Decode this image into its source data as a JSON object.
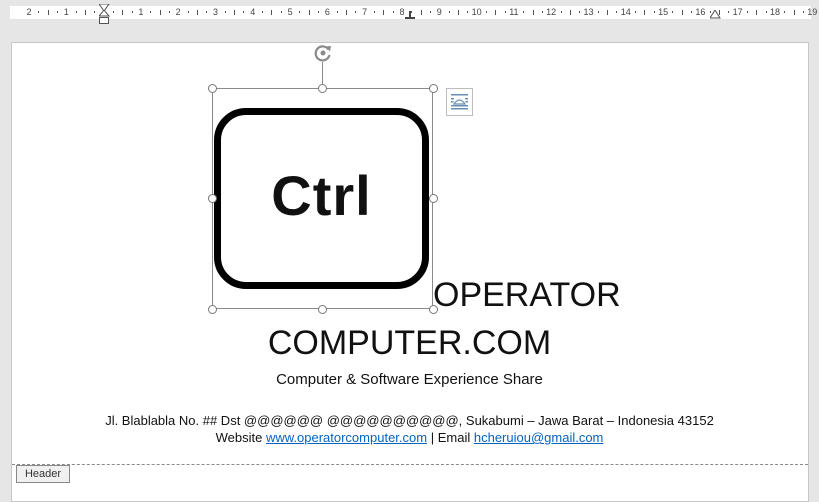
{
  "ruler": {
    "numbers": [
      "2",
      "1",
      "",
      "1",
      "2",
      "3",
      "4",
      "5",
      "6",
      "7",
      "8",
      "9",
      "10",
      "11",
      "12",
      "13",
      "14",
      "15",
      "16",
      "17",
      "18",
      "19"
    ]
  },
  "picture": {
    "key_label": "Ctrl",
    "icon": "ctrl-key-icon"
  },
  "layout_options_icon": "layout-options-icon",
  "rotate_icon": "rotate-handle-icon",
  "document": {
    "title_line1": "OPERATOR",
    "title_line2": "COMPUTER.COM",
    "tagline": "Computer & Software Experience Share",
    "address": "Jl. Blablabla No. ## Dst @@@@@@ @@@@@@@@@@, Sukabumi – Jawa Barat – Indonesia 43152",
    "website_label": "Website",
    "website_url": "www.operatorcomputer.com",
    "separator": "|",
    "email_label": "Email",
    "email": "hcheruiou@gmail.com"
  },
  "header_tab_label": "Header",
  "colors": {
    "link": "#0563c1",
    "ruler_bg": "#e6e6e6",
    "page_bg": "#ffffff"
  }
}
